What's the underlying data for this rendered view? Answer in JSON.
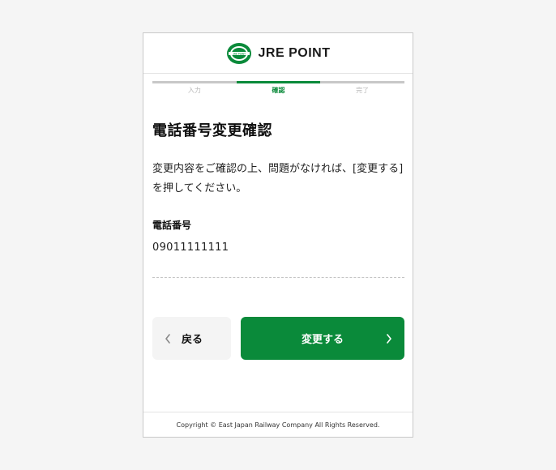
{
  "header": {
    "logo_text": "JRE POINT",
    "logo_mark_text": "JRE POINT"
  },
  "steps": [
    {
      "label": "入力",
      "active": false
    },
    {
      "label": "確認",
      "active": true
    },
    {
      "label": "完了",
      "active": false
    }
  ],
  "page": {
    "title": "電話番号変更確認",
    "description_line1": "変更内容をご確認の上、問題がなければ、[変更する]",
    "description_line2": "を押してください。"
  },
  "field": {
    "label": "電話番号",
    "value": "09011111111"
  },
  "buttons": {
    "back_label": "戻る",
    "submit_label": "変更する"
  },
  "footer": {
    "copyright": "Copyright © East Japan Railway Company All Rights Reserved."
  },
  "colors": {
    "brand_green": "#0a8a3a",
    "step_inactive": "#c8c8c8"
  },
  "icons": {
    "back": "chevron-left-icon",
    "submit": "chevron-right-icon",
    "logo": "jre-point-logo-icon"
  }
}
